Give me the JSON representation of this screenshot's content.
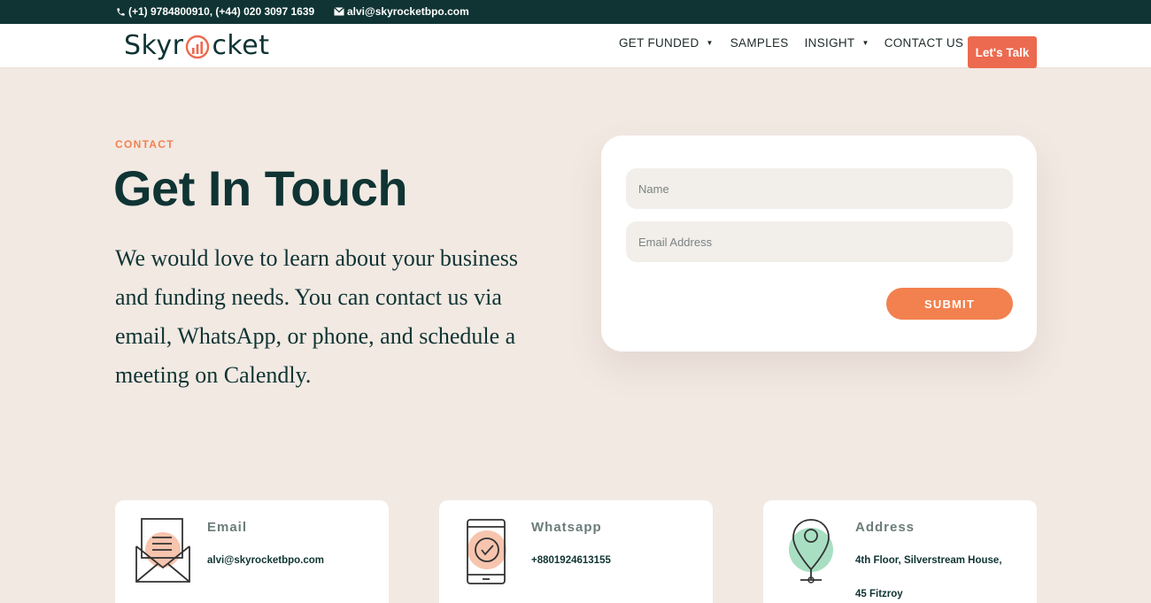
{
  "topbar": {
    "phone": "(+1) 9784800910, (+44) 020 3097 1639",
    "email": "alvi@skyrocketbpo.com"
  },
  "header": {
    "logo_left": "Skyr",
    "logo_right": "cket",
    "nav": [
      {
        "label": "GET FUNDED",
        "has_dropdown": true
      },
      {
        "label": "SAMPLES",
        "has_dropdown": false
      },
      {
        "label": "INSIGHT",
        "has_dropdown": true
      },
      {
        "label": "CONTACT US",
        "has_dropdown": false
      }
    ],
    "cta_label": "Let's Talk"
  },
  "hero": {
    "eyebrow": "CONTACT",
    "title": "Get In Touch",
    "intro": "We would love to learn about your business and funding needs. You can contact us via email, WhatsApp, or phone, and schedule a meeting on Calendly."
  },
  "form": {
    "name_placeholder": "Name",
    "name_value": "",
    "email_placeholder": "Email Address",
    "email_value": "",
    "submit_label": "SUBMIT"
  },
  "cards": [
    {
      "title": "Email",
      "value": "alvi@skyrocketbpo.com",
      "icon": "envelope-icon"
    },
    {
      "title": "Whatsapp",
      "value": "+8801924613155",
      "icon": "phone-check-icon"
    },
    {
      "title": "Address",
      "value": "4th Floor, Silverstream House,",
      "value2": "45 Fitzroy",
      "icon": "location-pin-icon"
    }
  ],
  "colors": {
    "dark_teal": "#0f3433",
    "accent_orange": "#f2814f",
    "cta_red": "#ec6a4f",
    "page_bg": "#f2e9e3",
    "input_bg": "#f2efeb"
  }
}
